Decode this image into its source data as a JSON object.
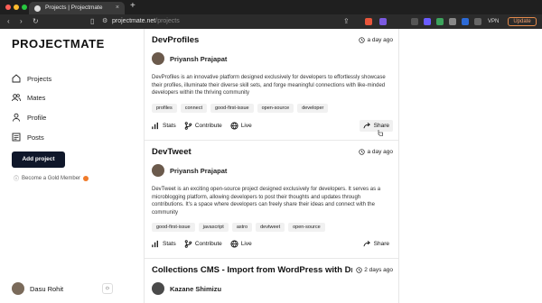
{
  "browser": {
    "tab_title": "Projects | Projectmate",
    "tab_close": "×",
    "new_tab": "+",
    "url_domain": "projectmate.net",
    "url_path": "/projects",
    "vpn_label": "VPN",
    "update_label": "Update"
  },
  "sidebar": {
    "logo": "PROJECTMATE",
    "items": [
      {
        "label": "Projects",
        "icon": "home-icon"
      },
      {
        "label": "Mates",
        "icon": "users-icon"
      },
      {
        "label": "Profile",
        "icon": "user-icon"
      },
      {
        "label": "Posts",
        "icon": "posts-icon"
      }
    ],
    "add_project": "Add project",
    "gold_member": "Become a Gold Member",
    "user_name": "Dasu Rohit",
    "theme_icon": "sun-icon"
  },
  "projects": [
    {
      "title": "DevProfiles",
      "time": "a day ago",
      "author": "Priyansh Prajapat",
      "description": "DevProfiles is an innovative platform designed exclusively for developers to effortlessly showcase their profiles, illuminate their diverse skill sets, and forge meaningful connections with like-minded developers within the thriving community",
      "tags": [
        "profiles",
        "connect",
        "good-first-issue",
        "open-source",
        "developer"
      ],
      "actions": {
        "stats": "Stats",
        "contribute": "Contribute",
        "live": "Live",
        "share": "Share"
      }
    },
    {
      "title": "DevTweet",
      "time": "a day ago",
      "author": "Priyansh Prajapat",
      "description": "DevTweet is an exciting open-source project designed exclusively for developers. It serves as a microblogging platform, allowing developers to post their thoughts and updates through contributions. It's a space where developers can freely share their ideas and connect with the community",
      "tags": [
        "good-first-issue",
        "javascript",
        "astro",
        "devtweet",
        "open-source"
      ],
      "actions": {
        "stats": "Stats",
        "contribute": "Contribute",
        "live": "Live",
        "share": "Share"
      }
    },
    {
      "title": "Collections CMS - Import from WordPress with Drag and Drop",
      "time": "2 days ago",
      "author": "Kazane Shimizu"
    }
  ],
  "colors": {
    "primary": "#0f172a",
    "gold_badge": "#f07b2a",
    "update_accent": "#e58a4a"
  }
}
